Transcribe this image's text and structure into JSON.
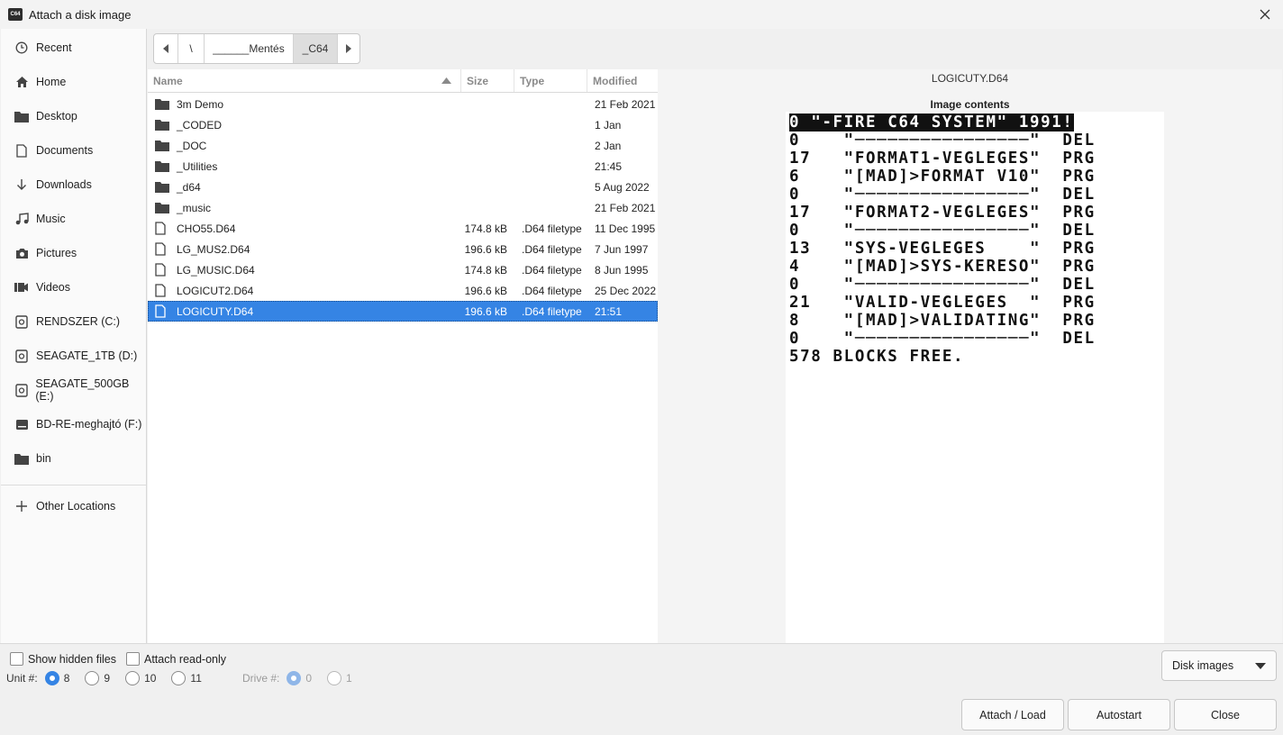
{
  "window": {
    "title": "Attach a disk image"
  },
  "sidebar": {
    "items": [
      {
        "label": "Recent",
        "icon": "clock-icon"
      },
      {
        "label": "Home",
        "icon": "home-icon"
      },
      {
        "label": "Desktop",
        "icon": "folder-icon"
      },
      {
        "label": "Documents",
        "icon": "document-icon"
      },
      {
        "label": "Downloads",
        "icon": "download-icon"
      },
      {
        "label": "Music",
        "icon": "music-icon"
      },
      {
        "label": "Pictures",
        "icon": "camera-icon"
      },
      {
        "label": "Videos",
        "icon": "video-icon"
      },
      {
        "label": "RENDSZER (C:)",
        "icon": "drive-icon"
      },
      {
        "label": "SEAGATE_1TB (D:)",
        "icon": "drive-icon"
      },
      {
        "label": "SEAGATE_500GB (E:)",
        "icon": "drive-icon"
      },
      {
        "label": "BD-RE-meghajtó (F:)",
        "icon": "optical-drive-icon"
      },
      {
        "label": "bin",
        "icon": "folder-icon"
      }
    ],
    "other_locations": "Other Locations"
  },
  "pathbar": {
    "segments": [
      "\\",
      "______Mentés",
      "_C64"
    ]
  },
  "filelist": {
    "headers": {
      "name": "Name",
      "size": "Size",
      "type": "Type",
      "modified": "Modified"
    },
    "rows": [
      {
        "name": "3m Demo",
        "size": "",
        "type": "",
        "modified": "21 Feb 2021",
        "kind": "folder"
      },
      {
        "name": "_CODED",
        "size": "",
        "type": "",
        "modified": "1 Jan",
        "kind": "folder"
      },
      {
        "name": "_DOC",
        "size": "",
        "type": "",
        "modified": "2 Jan",
        "kind": "folder"
      },
      {
        "name": "_Utilities",
        "size": "",
        "type": "",
        "modified": "21:45",
        "kind": "folder"
      },
      {
        "name": "_d64",
        "size": "",
        "type": "",
        "modified": "5 Aug 2022",
        "kind": "folder"
      },
      {
        "name": "_music",
        "size": "",
        "type": "",
        "modified": "21 Feb 2021",
        "kind": "folder"
      },
      {
        "name": "CHO55.D64",
        "size": "174.8 kB",
        "type": ".D64 filetype",
        "modified": "11 Dec 1995",
        "kind": "file"
      },
      {
        "name": "LG_MUS2.D64",
        "size": "196.6 kB",
        "type": ".D64 filetype",
        "modified": "7 Jun 1997",
        "kind": "file"
      },
      {
        "name": "LG_MUSIC.D64",
        "size": "174.8 kB",
        "type": ".D64 filetype",
        "modified": "8 Jun 1995",
        "kind": "file"
      },
      {
        "name": "LOGICUT2.D64",
        "size": "196.6 kB",
        "type": ".D64 filetype",
        "modified": "25 Dec 2022",
        "kind": "file"
      },
      {
        "name": "LOGICUTY.D64",
        "size": "196.6 kB",
        "type": ".D64 filetype",
        "modified": "21:51",
        "kind": "file",
        "selected": true
      }
    ]
  },
  "preview": {
    "filename": "LOGICUTY.D64",
    "caption": "Image contents",
    "header_line": "0 \"-FIRE C64 SYSTEM\" 1991!",
    "lines": [
      "0    \"────────────────\"  DEL",
      "17   \"FORMAT1-VEGLEGES\"  PRG",
      "6    \"[MAD]>FORMAT V10\"  PRG",
      "0    \"────────────────\"  DEL",
      "17   \"FORMAT2-VEGLEGES\"  PRG",
      "0    \"────────────────\"  DEL",
      "13   \"SYS-VEGLEGES    \"  PRG",
      "4    \"[MAD]>SYS-KERESO\"  PRG",
      "0    \"────────────────\"  DEL",
      "21   \"VALID-VEGLEGES  \"  PRG",
      "8    \"[MAD]>VALIDATING\"  PRG",
      "0    \"────────────────\"  DEL",
      "578 BLOCKS FREE."
    ]
  },
  "options": {
    "show_hidden": "Show hidden files",
    "attach_readonly": "Attach read-only",
    "unit_label": "Unit #:",
    "units": [
      "8",
      "9",
      "10",
      "11"
    ],
    "unit_selected": "8",
    "drive_label": "Drive #:",
    "drives": [
      "0",
      "1"
    ],
    "drive_selected": "0"
  },
  "filter": {
    "value": "Disk images"
  },
  "buttons": {
    "attach": "Attach / Load",
    "autostart": "Autostart",
    "close": "Close"
  },
  "colors": {
    "accent": "#3584e4"
  }
}
